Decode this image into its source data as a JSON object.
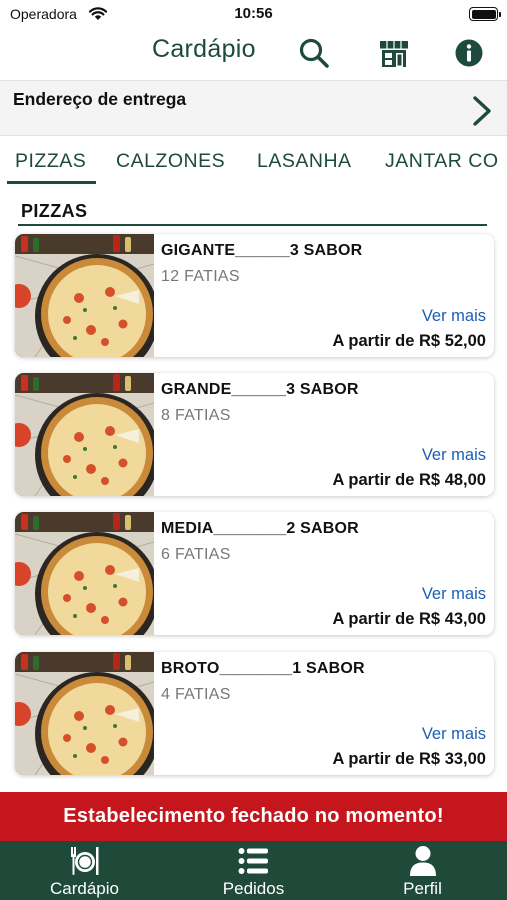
{
  "status_bar": {
    "carrier": "Operadora",
    "time": "10:56"
  },
  "header": {
    "title": "Cardápio",
    "icons": [
      "search-icon",
      "store-icon",
      "info-icon"
    ]
  },
  "address": {
    "label": "Endereço de entrega"
  },
  "tabs": [
    "PIZZAS",
    "CALZONES",
    "LASANHA",
    "JANTAR CO"
  ],
  "active_tab": "PIZZAS",
  "section": {
    "title": "PIZZAS"
  },
  "products": [
    {
      "name": "GIGANTE______3 SABOR",
      "subtitle": "12 FATIAS",
      "more": "Ver mais",
      "price": "A partir de R$ 52,00"
    },
    {
      "name": "GRANDE______3 SABOR",
      "subtitle": "8 FATIAS",
      "more": "Ver mais",
      "price": "A partir de R$ 48,00"
    },
    {
      "name": "MEDIA________2 SABOR",
      "subtitle": "6 FATIAS",
      "more": "Ver mais",
      "price": "A partir de R$ 43,00"
    },
    {
      "name": "BROTO________1 SABOR",
      "subtitle": "4 FATIAS",
      "more": "Ver mais",
      "price": "A partir de R$ 33,00"
    }
  ],
  "closed_notice": "Estabelecimento fechado no momento!",
  "bottom_nav": [
    {
      "label": "Cardápio",
      "icon": "cutlery-plate-icon"
    },
    {
      "label": "Pedidos",
      "icon": "list-icon"
    },
    {
      "label": "Perfil",
      "icon": "user-icon"
    }
  ],
  "colors": {
    "brand_green": "#1d4a3c",
    "nav_green": "#1f4a3a",
    "closed_red": "#c4161c",
    "link_blue": "#1a5fb4"
  }
}
